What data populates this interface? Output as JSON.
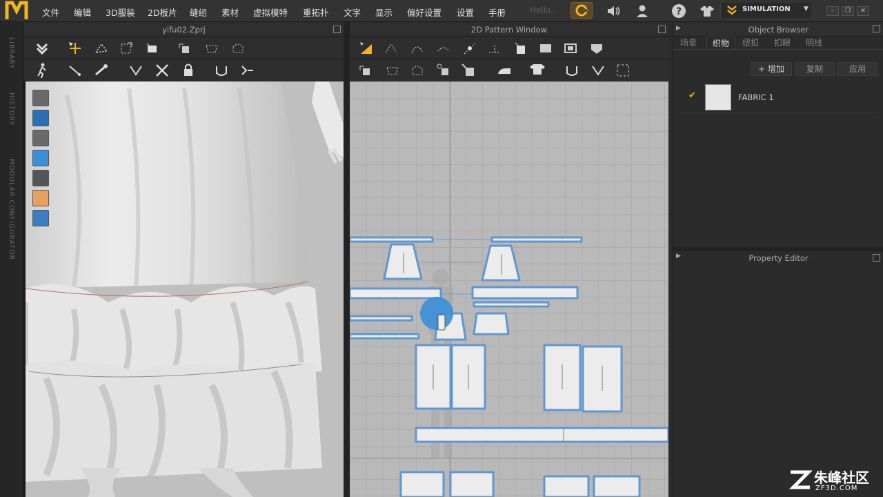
{
  "menubar": {
    "items": [
      "文件",
      "编辑",
      "3D服装",
      "2D板片",
      "缝纫",
      "素材",
      "虚拟模特",
      "重拓扑",
      "文字",
      "显示",
      "偏好设置",
      "设置",
      "手册"
    ],
    "hello": "Hello,",
    "simulation_label": "SIMULATION"
  },
  "side_tabs": [
    "LIBRARY",
    "HISTORY",
    "MODULAR CONFIGURATOR"
  ],
  "panel3d": {
    "title": "yifu02.Zprj"
  },
  "panel2d": {
    "title": "2D Pattern Window"
  },
  "object_browser": {
    "title": "Object Browser",
    "tabs": [
      "场景",
      "织物",
      "纽扣",
      "扣眼",
      "明线"
    ],
    "active_tab": "织物",
    "buttons": {
      "add": "增加",
      "copy": "复制",
      "apply": "应用"
    },
    "fabric_items": [
      {
        "name": "FABRIC 1"
      }
    ]
  },
  "property_editor": {
    "title": "Property Editor"
  },
  "watermark": {
    "line1": "朱峰社区",
    "line2": "ZF3D.COM"
  },
  "colors": {
    "accent": "#f2b51e",
    "selection": "#3a8fd8",
    "pattern_outline": "#5f97d1"
  }
}
